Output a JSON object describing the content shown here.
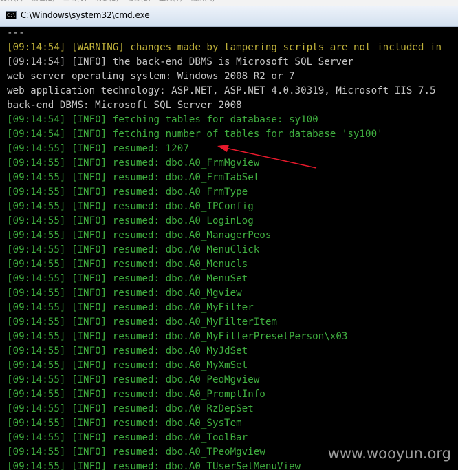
{
  "window": {
    "title": "C:\\Windows\\system32\\cmd.exe",
    "menu_items": [
      "文件(F)",
      "编辑(E)",
      "查看(V)",
      "历史(S)",
      "书签(B)",
      "工具(T)",
      "帮助(H)"
    ]
  },
  "colors": {
    "yellow": "#c0b23a",
    "white": "#c6c6c6",
    "green": "#3fae3f",
    "arrow": "#e8192c"
  },
  "console": {
    "lines": [
      {
        "text": "---",
        "color": "white"
      },
      {
        "text": "[09:14:54] [WARNING] changes made by tampering scripts are not included in",
        "color": "yellow"
      },
      {
        "text": "[09:14:54] [INFO] the back-end DBMS is Microsoft SQL Server",
        "color": "white"
      },
      {
        "text": "web server operating system: Windows 2008 R2 or 7",
        "color": "white"
      },
      {
        "text": "web application technology: ASP.NET, ASP.NET 4.0.30319, Microsoft IIS 7.5",
        "color": "white"
      },
      {
        "text": "back-end DBMS: Microsoft SQL Server 2008",
        "color": "white"
      },
      {
        "text": "[09:14:54] [INFO] fetching tables for database: sy100",
        "color": "green"
      },
      {
        "text": "[09:14:54] [INFO] fetching number of tables for database 'sy100'",
        "color": "green"
      },
      {
        "text": "[09:14:55] [INFO] resumed: 1207",
        "color": "green"
      },
      {
        "text": "[09:14:55] [INFO] resumed: dbo.A0_FrmMgview",
        "color": "green"
      },
      {
        "text": "[09:14:55] [INFO] resumed: dbo.A0_FrmTabSet",
        "color": "green"
      },
      {
        "text": "[09:14:55] [INFO] resumed: dbo.A0_FrmType",
        "color": "green"
      },
      {
        "text": "[09:14:55] [INFO] resumed: dbo.A0_IPConfig",
        "color": "green"
      },
      {
        "text": "[09:14:55] [INFO] resumed: dbo.A0_LoginLog",
        "color": "green"
      },
      {
        "text": "[09:14:55] [INFO] resumed: dbo.A0_ManagerPeos",
        "color": "green"
      },
      {
        "text": "[09:14:55] [INFO] resumed: dbo.A0_MenuClick",
        "color": "green"
      },
      {
        "text": "[09:14:55] [INFO] resumed: dbo.A0_Menucls",
        "color": "green"
      },
      {
        "text": "[09:14:55] [INFO] resumed: dbo.A0_MenuSet",
        "color": "green"
      },
      {
        "text": "[09:14:55] [INFO] resumed: dbo.A0_Mgview",
        "color": "green"
      },
      {
        "text": "[09:14:55] [INFO] resumed: dbo.A0_MyFilter",
        "color": "green"
      },
      {
        "text": "[09:14:55] [INFO] resumed: dbo.A0_MyFilterItem",
        "color": "green"
      },
      {
        "text": "[09:14:55] [INFO] resumed: dbo.A0_MyFilterPresetPerson\\x03",
        "color": "green"
      },
      {
        "text": "[09:14:55] [INFO] resumed: dbo.A0_MyJdSet",
        "color": "green"
      },
      {
        "text": "[09:14:55] [INFO] resumed: dbo.A0_MyXmSet",
        "color": "green"
      },
      {
        "text": "[09:14:55] [INFO] resumed: dbo.A0_PeoMgview",
        "color": "green"
      },
      {
        "text": "[09:14:55] [INFO] resumed: dbo.A0_PromptInfo",
        "color": "green"
      },
      {
        "text": "[09:14:55] [INFO] resumed: dbo.A0_RzDepSet",
        "color": "green"
      },
      {
        "text": "[09:14:55] [INFO] resumed: dbo.A0_SysTem",
        "color": "green"
      },
      {
        "text": "[09:14:55] [INFO] resumed: dbo.A0_ToolBar",
        "color": "green"
      },
      {
        "text": "[09:14:55] [INFO] resumed: dbo.A0_TPeoMgview",
        "color": "green"
      },
      {
        "text": "[09:14:55] [INFO] resumed: dbo.A0_TUserSetMenuView",
        "color": "green"
      }
    ]
  },
  "watermark": "www.wooyun.org"
}
